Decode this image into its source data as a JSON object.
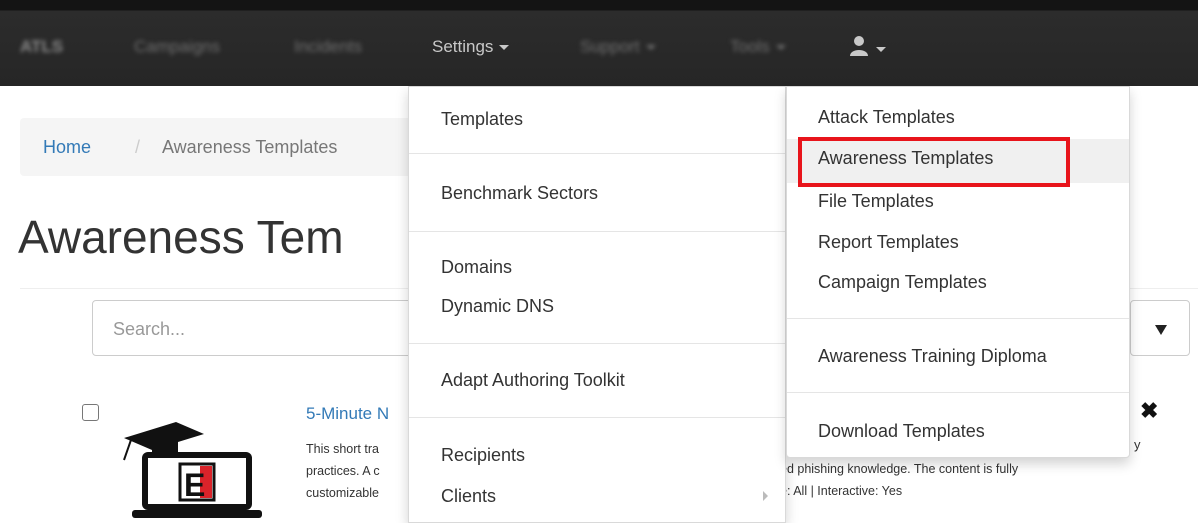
{
  "navbar": {
    "brand": "ATLS",
    "items": [
      {
        "label": "Campaigns"
      },
      {
        "label": "Incidents"
      },
      {
        "label": "Settings"
      },
      {
        "label": "Support"
      },
      {
        "label": "Tools"
      }
    ],
    "user_icon": "user-icon"
  },
  "breadcrumb": {
    "home": "Home",
    "separator": "/",
    "current": "Awareness Templates"
  },
  "page": {
    "title": "Awareness Tem"
  },
  "search": {
    "placeholder": "Search..."
  },
  "settings_menu": {
    "items": [
      "Templates",
      "Benchmark Sectors",
      "Domains",
      "Dynamic DNS",
      "Adapt Authoring Toolkit",
      "Recipients",
      "Clients"
    ]
  },
  "templates_submenu": {
    "items": [
      "Attack Templates",
      "Awareness Templates",
      "File Templates",
      "Report Templates",
      "Campaign Templates",
      "Awareness Training Diploma",
      "Download Templates"
    ],
    "highlight_color": "#e8141b"
  },
  "list_item": {
    "title": "5-Minute N",
    "desc_lines": [
      "This short tra",
      "practices. A c",
      "customizable"
    ],
    "desc_right_lines": [
      "ed phishing knowledge. The content is fully",
      "e: All | Interactive: Yes"
    ],
    "right_y": "y",
    "close": "✖"
  }
}
